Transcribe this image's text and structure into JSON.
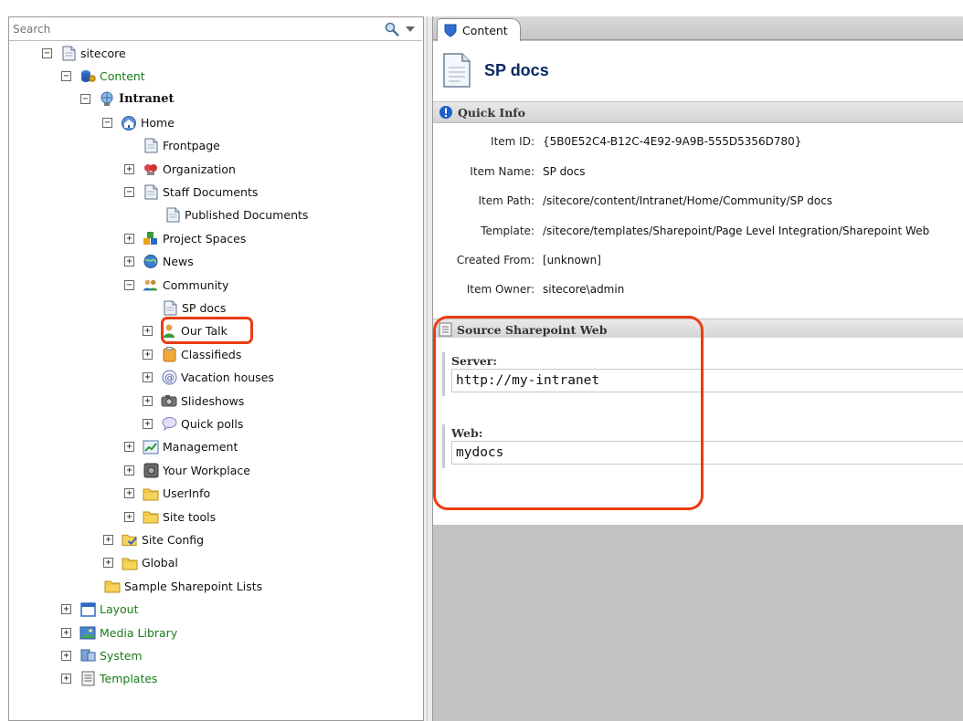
{
  "search": {
    "placeholder": "Search"
  },
  "tree": [
    {
      "label": "sitecore",
      "toggle": "minus",
      "icon": "page-icon",
      "style": ""
    },
    {
      "label": "Content",
      "toggle": "minus",
      "icon": "content-db-icon",
      "style": "green"
    },
    {
      "label": "Intranet",
      "toggle": "minus",
      "icon": "globe-person-icon",
      "style": "bold"
    },
    {
      "label": "Home",
      "toggle": "minus",
      "icon": "home-icon",
      "style": ""
    },
    {
      "label": "Frontpage",
      "toggle": "",
      "icon": "page-icon",
      "style": ""
    },
    {
      "label": "Organization",
      "toggle": "plus",
      "icon": "organization-icon",
      "style": ""
    },
    {
      "label": "Staff Documents",
      "toggle": "minus",
      "icon": "page-icon",
      "style": ""
    },
    {
      "label": "Published Documents",
      "toggle": "",
      "icon": "page-icon",
      "style": ""
    },
    {
      "label": "Project Spaces",
      "toggle": "plus",
      "icon": "project-spaces-icon",
      "style": ""
    },
    {
      "label": "News",
      "toggle": "plus",
      "icon": "news-globe-icon",
      "style": ""
    },
    {
      "label": "Community",
      "toggle": "minus",
      "icon": "community-people-icon",
      "style": ""
    },
    {
      "label": "SP docs",
      "toggle": "",
      "icon": "page-icon",
      "style": ""
    },
    {
      "label": "Our Talk",
      "toggle": "plus",
      "icon": "person-green-icon",
      "style": ""
    },
    {
      "label": "Classifieds",
      "toggle": "plus",
      "icon": "clipboard-icon",
      "style": ""
    },
    {
      "label": "Vacation houses",
      "toggle": "plus",
      "icon": "at-sign-icon",
      "style": ""
    },
    {
      "label": "Slideshows",
      "toggle": "plus",
      "icon": "camera-icon",
      "style": ""
    },
    {
      "label": "Quick polls",
      "toggle": "plus",
      "icon": "speech-bubble-icon",
      "style": ""
    },
    {
      "label": "Management",
      "toggle": "plus",
      "icon": "chart-icon",
      "style": ""
    },
    {
      "label": "Your Workplace",
      "toggle": "plus",
      "icon": "safe-icon",
      "style": ""
    },
    {
      "label": "UserInfo",
      "toggle": "plus",
      "icon": "folder-icon",
      "style": ""
    },
    {
      "label": "Site tools",
      "toggle": "plus",
      "icon": "folder-icon",
      "style": ""
    },
    {
      "label": "Site Config",
      "toggle": "plus",
      "icon": "folder-check-icon",
      "style": ""
    },
    {
      "label": "Global",
      "toggle": "plus",
      "icon": "folder-icon",
      "style": ""
    },
    {
      "label": "Sample Sharepoint Lists",
      "toggle": "",
      "icon": "folder-icon",
      "style": ""
    },
    {
      "label": "Layout",
      "toggle": "plus",
      "icon": "layout-window-icon",
      "style": "green"
    },
    {
      "label": "Media Library",
      "toggle": "plus",
      "icon": "media-image-icon",
      "style": "green"
    },
    {
      "label": "System",
      "toggle": "plus",
      "icon": "system-icon",
      "style": "green"
    },
    {
      "label": "Templates",
      "toggle": "plus",
      "icon": "templates-icon",
      "style": "green"
    }
  ],
  "tab": {
    "label": "Content"
  },
  "item": {
    "title": "SP docs"
  },
  "quick_info": {
    "heading": "Quick Info",
    "rows": [
      {
        "key": "Item ID:",
        "value": "{5B0E52C4-B12C-4E92-9A9B-555D5356D780}"
      },
      {
        "key": "Item Name:",
        "value": "SP docs"
      },
      {
        "key": "Item Path:",
        "value": "/sitecore/content/Intranet/Home/Community/SP docs"
      },
      {
        "key": "Template:",
        "value": "/sitecore/templates/Sharepoint/Page Level Integration/Sharepoint Web"
      },
      {
        "key": "Created From:",
        "value": "[unknown]"
      },
      {
        "key": "Item Owner:",
        "value": "sitecore\\admin"
      }
    ]
  },
  "source_section": {
    "heading": "Source Sharepoint Web",
    "server_label": "Server:",
    "server_value": "http://my-intranet",
    "web_label": "Web:",
    "web_value": "mydocs"
  },
  "colors": {
    "highlight": "#ea3c12",
    "green_label": "#1a7a1a",
    "title": "#0a2a63"
  }
}
